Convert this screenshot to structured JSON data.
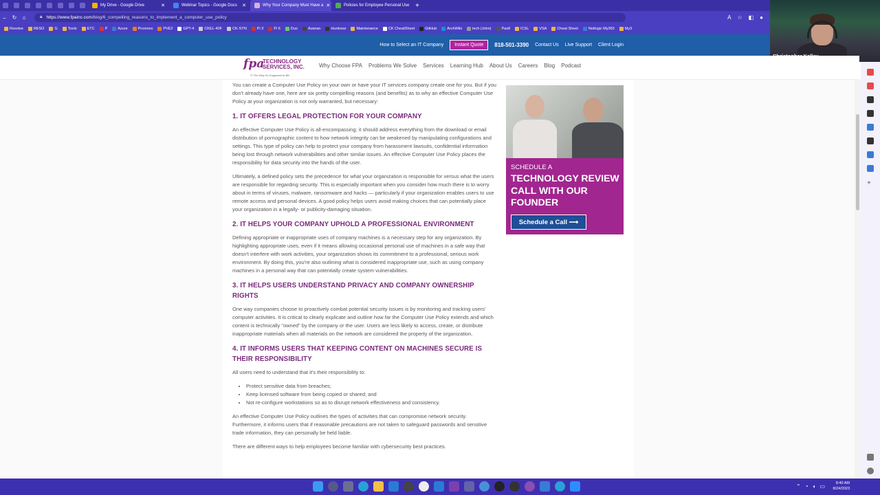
{
  "browser": {
    "tabs": [
      {
        "title": "My Drive - Google Drive",
        "color": "#f4b400"
      },
      {
        "title": "Webinar Topics - Google Docs",
        "color": "#4285f4"
      },
      {
        "title": "Why Your Company Must Have a",
        "color": "#8a2a86",
        "active": true
      },
      {
        "title": "Policies for Employee Personal Use",
        "color": "#4caf50"
      }
    ],
    "url_host": "https://www.fpainc.com",
    "url_path": "/blog/6_compelling_reasons_to_implement_a_computer_use_policy",
    "bookmarks": [
      "Resolve",
      "RESO",
      "G",
      "Tools",
      "ETC",
      "P",
      "Azure",
      "Proxmox",
      "PVE2",
      "GPT-4",
      "CKEL-40F",
      "CK-SYN",
      "Pi 3",
      "Pi 6",
      "Duo",
      "Avanan",
      "Huntress",
      "Maintenance",
      "CK CheatSheet",
      "GitHub",
      "ArchWiki",
      "tech (John)",
      "Pax8",
      "ICSL",
      "VSA",
      "Cheat Sheet",
      "Netlogic My365",
      "My3"
    ]
  },
  "webcam": {
    "name": "Christopher Kelley"
  },
  "topbar": {
    "links": [
      "How to Select an IT Company"
    ],
    "quote": "Instant Quote",
    "phone": "818-501-3390",
    "right_links": [
      "Contact Us",
      "Live Support",
      "Client Login"
    ]
  },
  "logo": {
    "mark": "fpa",
    "line1": "TECHNOLOGY",
    "line2": "SERVICES, INC.",
    "tagline": "IT The Way It's Supposed to Be!"
  },
  "nav": [
    "Why Choose FPA",
    "Problems We Solve",
    "Services",
    "Learning Hub",
    "About Us",
    "Careers",
    "Blog",
    "Podcast"
  ],
  "article": {
    "intro": "You can create a Computer Use Policy on your own or have your IT services company create one for you. But if you don't already have one, here are six pretty compelling reasons (and benefits) as to why an effective Computer Use Policy at your organization is not only warranted, but necessary:",
    "h1": "1. IT OFFERS LEGAL PROTECTION FOR YOUR COMPANY",
    "p1a": "An effective Computer Use Policy is all-encompassing; it should address everything from the download or email distribution of pornographic content to how network integrity can be weakened by manipulating configurations and settings. This type of policy can help to protect your company from harassment lawsuits, confidential information being lost through network vulnerabilities and other similar issues. An effective Computer Use Policy places the responsibility for data security into the hands of the user.",
    "p1b": "Ultimately, a defined policy sets the precedence for what your organization is responsible for versus what the users are responsible for regarding security. This is especially important when you consider how much there is to worry about in terms of viruses, malware, ransomware and hacks — particularly if your organization enables users to use remote access and personal devices. A good policy helps users avoid making choices that can potentially place your organization in a legally- or publicity-damaging situation.",
    "h2": "2. IT HELPS YOUR COMPANY UPHOLD A PROFESSIONAL ENVIRONMENT",
    "p2": "Defining appropriate or inappropriate uses of company machines is a necessary step for any organization. By highlighting appropriate uses, even if it means allowing occasional personal use of machines in a safe way that doesn't interfere with work activities, your organization shows its commitment to a professional, serious work environment. By doing this, you're also outlining what is considered inappropriate use, such as using company machines in a personal way that can potentially create system vulnerabilities.",
    "h3": "3. IT HELPS USERS UNDERSTAND PRIVACY AND COMPANY OWNERSHIP RIGHTS",
    "p3": "One way companies choose to proactively combat potential security issues is by monitoring and tracking users' computer activities. It is critical to clearly explicate and outline how far the Computer Use Policy extends and which content is technically \"owned\" by the company or the user. Users are less likely to access, create, or distribute inappropriate materials when all materials on the network are considered the property of the organization.",
    "h4": "4. IT INFORMS USERS THAT KEEPING CONTENT ON MACHINES SECURE IS THEIR RESPONSIBILITY",
    "p4": "All users need to understand that it's their responsibility to:",
    "bullets": [
      "Protect sensitive data from breaches;",
      "Keep licensed software from being copied or shared; and",
      "Not re-configure workstations so as to disrupt network effectiveness and consistency."
    ],
    "p5": "An effective Computer Use Policy outlines the types of activities that can compromise network security. Furthermore, it informs users that if reasonable precautions are not taken to safeguard passwords and sensitive trade information, they can personally be held liable.",
    "p6": "There are different ways to help employees become familiar with cybersecurity best practices."
  },
  "ad": {
    "kicker": "SCHEDULE A",
    "headline": "TECHNOLOGY REVIEW CALL WITH OUR FOUNDER",
    "cta": "Schedule a Call ⟶"
  },
  "taskbar": {
    "time": "8:40 AM",
    "date": "8/24/2023"
  },
  "colors": {
    "accent": "#7a2a7c",
    "brand_blue": "#1f5fa8",
    "ad_purple": "#a2268f"
  }
}
